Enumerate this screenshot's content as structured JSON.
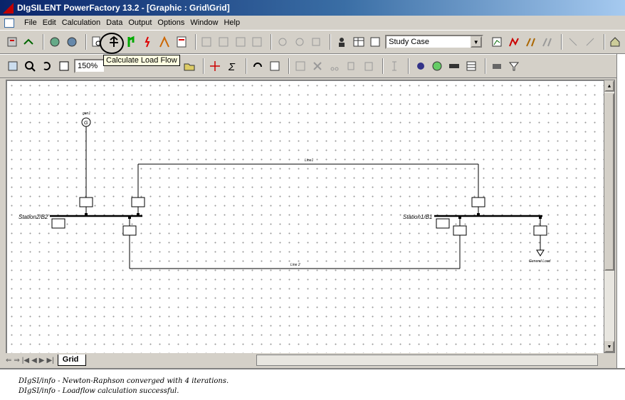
{
  "window": {
    "title": "DIgSILENT PowerFactory 13.2 - [Graphic : Grid\\Grid]"
  },
  "menu": [
    "File",
    "Edit",
    "Calculation",
    "Data",
    "Output",
    "Options",
    "Window",
    "Help"
  ],
  "toolbar": {
    "study_case": "Study Case",
    "zoom": "150%",
    "tooltip": "Calculate Load Flow"
  },
  "diagram": {
    "generator_label": "gen1",
    "generator_symbol": "G",
    "bus_left": "Station2/B2",
    "bus_right": "Station1/B1",
    "line_top": "Line1",
    "line_bottom": "Line 2",
    "load_label": "General Load"
  },
  "tabs": [
    "Grid"
  ],
  "output_lines": [
    "DIgSI/info - Newton-Raphson converged with 4 iterations.",
    "DIgSI/info - Loadflow calculation successful."
  ],
  "colors": {
    "title_start": "#0a246a",
    "title_end": "#a6caf0",
    "line": "#000000"
  }
}
